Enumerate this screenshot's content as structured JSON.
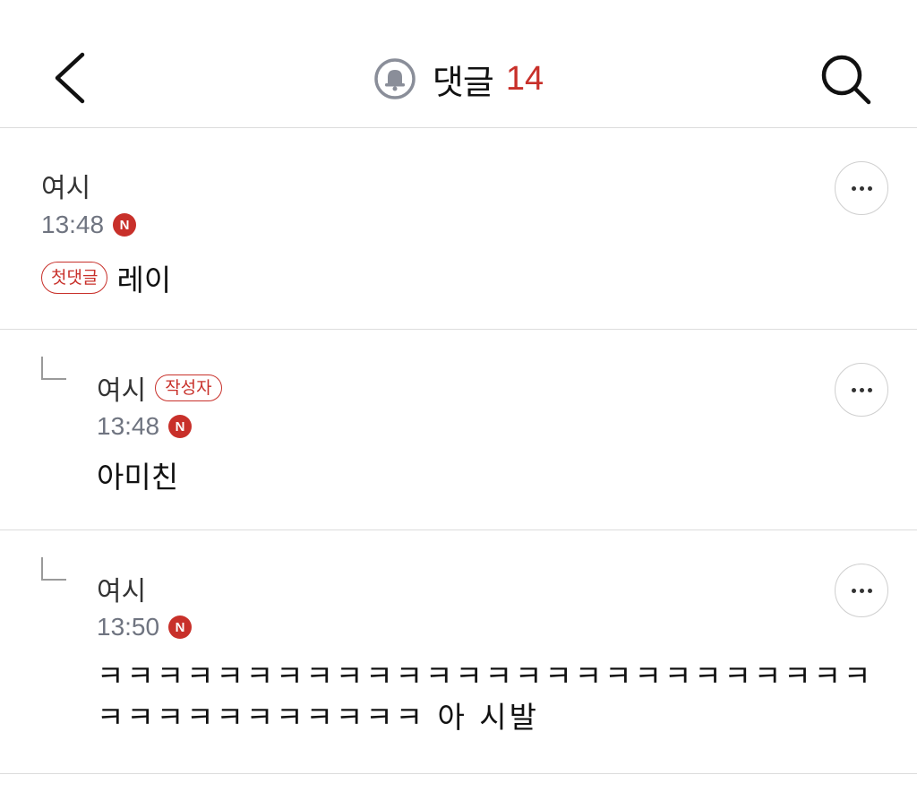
{
  "header": {
    "title": "댓글",
    "count": "14"
  },
  "comments": [
    {
      "author": "여시",
      "badge": "",
      "time": "13:48",
      "new_label": "N",
      "first_badge": "첫댓글",
      "text": "레이"
    },
    {
      "author": "여시",
      "badge": "작성자",
      "time": "13:48",
      "new_label": "N",
      "text": "아미친"
    },
    {
      "author": "여시",
      "time": "13:50",
      "new_label": "N",
      "text_line1": "ㅋㅋㅋㅋㅋㅋㅋㅋㅋㅋㅋㅋㅋㅋㅋㅋㅋㅋㅋㅋㅋㅋㅋㅋㅋㅋ",
      "text_line2": "ㅋㅋㅋㅋㅋㅋㅋㅋㅋㅋㅋ 아 시발"
    }
  ],
  "icons": {
    "back": "chevron-left-icon",
    "bell": "bell-icon",
    "search": "search-icon",
    "more": "more-dots-icon"
  },
  "colors": {
    "accent": "#c8302a",
    "time": "#6f7480"
  }
}
